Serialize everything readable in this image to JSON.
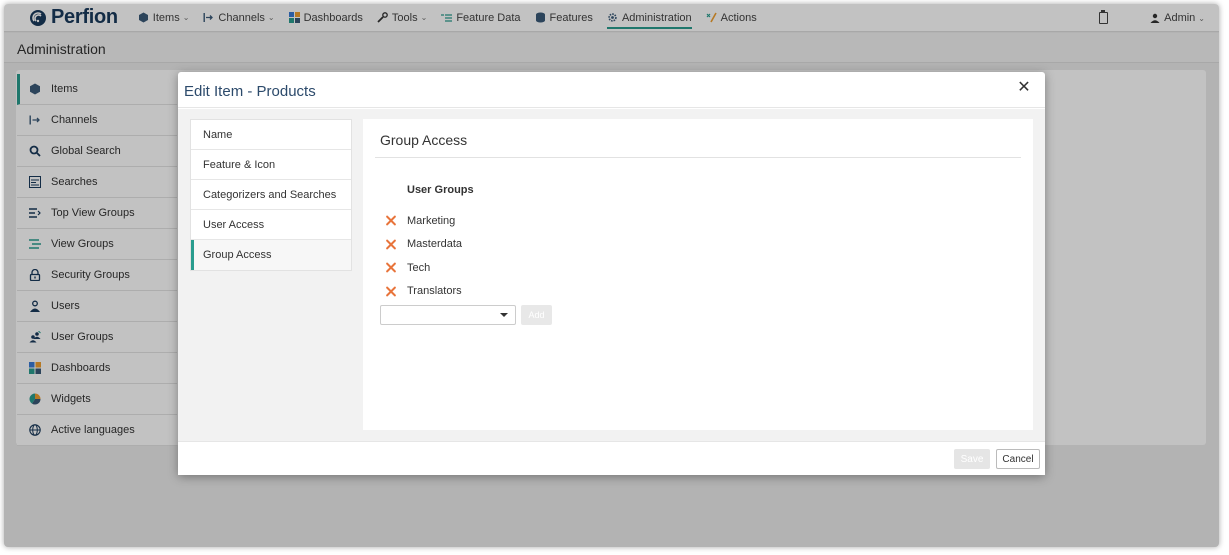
{
  "app": {
    "logo_text": "Perfion",
    "page_title": "Administration"
  },
  "nav": {
    "items": [
      {
        "label": "Items",
        "icon": "cube-icon",
        "caret": true
      },
      {
        "label": "Channels",
        "icon": "channel-arrow-icon",
        "caret": true
      },
      {
        "label": "Dashboards",
        "icon": "dashboard-grid-icon",
        "caret": false
      },
      {
        "label": "Tools",
        "icon": "wrench-icon",
        "caret": true
      },
      {
        "label": "Feature Data",
        "icon": "list-icon",
        "caret": false
      },
      {
        "label": "Features",
        "icon": "database-icon",
        "caret": false
      },
      {
        "label": "Administration",
        "icon": "gear-icon",
        "caret": false,
        "active": true
      },
      {
        "label": "Actions",
        "icon": "actions-icon",
        "caret": false
      }
    ],
    "user_label": "Admin"
  },
  "sidebar": {
    "items": [
      {
        "label": "Items",
        "active": true
      },
      {
        "label": "Channels"
      },
      {
        "label": "Global Search"
      },
      {
        "label": "Searches"
      },
      {
        "label": "Top View Groups"
      },
      {
        "label": "View Groups"
      },
      {
        "label": "Security Groups"
      },
      {
        "label": "Users"
      },
      {
        "label": "User Groups"
      },
      {
        "label": "Dashboards"
      },
      {
        "label": "Widgets"
      },
      {
        "label": "Active languages"
      }
    ]
  },
  "modal": {
    "title": "Edit Item - Products",
    "tabs": [
      {
        "label": "Name"
      },
      {
        "label": "Feature & Icon"
      },
      {
        "label": "Categorizers and Searches"
      },
      {
        "label": "User Access"
      },
      {
        "label": "Group Access",
        "active": true
      }
    ],
    "panel": {
      "title": "Group Access",
      "column_header": "User Groups",
      "groups": [
        "Marketing",
        "Masterdata",
        "Tech",
        "Translators"
      ],
      "select_value": "",
      "add_label": "Add"
    },
    "footer": {
      "save_label": "Save",
      "cancel_label": "Cancel"
    }
  },
  "colors": {
    "accent": "#2a9d8f",
    "remove": "#e8743b",
    "brand": "#1a3a5c"
  }
}
